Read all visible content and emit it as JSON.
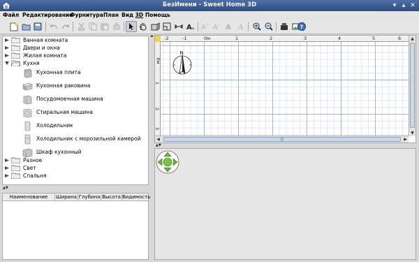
{
  "window": {
    "title": "БезИмени - Sweet Home 3D",
    "buttons": [
      "▾",
      "▴",
      "✕"
    ]
  },
  "menu": [
    {
      "label": "Файл"
    },
    {
      "label": "Редактирование"
    },
    {
      "label": "Фурнитура"
    },
    {
      "label": "План"
    },
    {
      "label": "Вид ",
      "underlined": "3D"
    },
    {
      "label": "Помощь"
    }
  ],
  "toolbar": {
    "tools": [
      "new-file",
      "open-file",
      "save-file",
      "undo",
      "redo",
      "cut",
      "copy",
      "paste",
      "add-furniture",
      "select",
      "pan",
      "create-walls",
      "create-rooms",
      "create-dimensions",
      "add-text",
      "increase-text",
      "decrease-text",
      "bold-text",
      "italic-text",
      "zoom-in",
      "zoom-out",
      "import-furniture",
      "import-background",
      "help"
    ]
  },
  "catalog": {
    "categories": [
      {
        "label": "Ванная комната",
        "expanded": false
      },
      {
        "label": "Двери и окна",
        "expanded": false
      },
      {
        "label": "Жилая комната",
        "expanded": false
      },
      {
        "label": "Кухня",
        "expanded": true,
        "items": [
          "Кухонная плита",
          "Кухонная раковина",
          "Посудомоечная машина",
          "Стиральная машина",
          "Холодильник",
          "Холодильник с морозильной камерой",
          "Шкаф кухонный"
        ]
      },
      {
        "label": "Разное",
        "expanded": false
      },
      {
        "label": "Свет",
        "expanded": false
      },
      {
        "label": "Спальня",
        "expanded": false
      }
    ]
  },
  "furniture_table": {
    "columns": [
      "Наименование",
      "Ширина",
      "Глубина",
      "Высота",
      "Видимость"
    ]
  },
  "plan": {
    "ruler_x": [
      "-2",
      "-1",
      "0м",
      "1",
      "2",
      "3",
      "4",
      "5",
      "6",
      "7"
    ],
    "ruler_y": [
      "0м",
      "1",
      "2",
      "3"
    ],
    "compass_label": "N",
    "hscroll_grip": "|||"
  }
}
